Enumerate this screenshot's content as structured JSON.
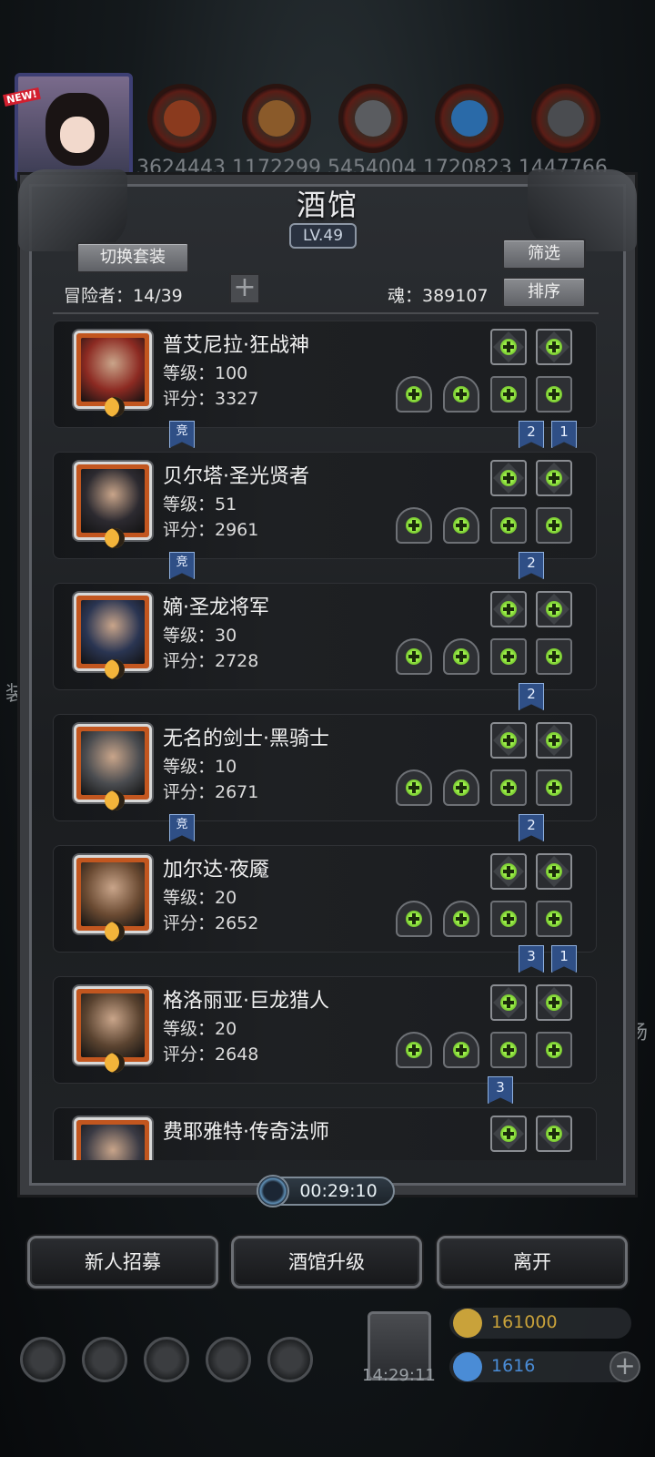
{
  "top_bar": {
    "new_badge": "NEW!",
    "resources_text": "3624443 1172299 5454004 1720823 1447766"
  },
  "tavern": {
    "title": "酒馆",
    "level": "LV.49",
    "switch_set_label": "切换套装",
    "filter_label": "筛选",
    "sort_label": "排序",
    "adventurers": "冒险者：14/39",
    "soul": "魂：389107",
    "heroes": [
      {
        "name": "普艾尼拉·狂战神",
        "level": "等级：100",
        "score": "评分：3327",
        "portrait_color": "#8c2a22",
        "jing": "竞",
        "ranks": [
          "2",
          "1"
        ]
      },
      {
        "name": "贝尔塔·圣光贤者",
        "level": "等级：51",
        "score": "评分：2961",
        "portrait_color": "#2c2a30",
        "jing": "竞",
        "ranks": [
          "2"
        ]
      },
      {
        "name": "嫡·圣龙将军",
        "level": "等级：30",
        "score": "评分：2728",
        "portrait_color": "#2a3552",
        "jing": "",
        "ranks": [
          "2"
        ]
      },
      {
        "name": "无名的剑士·黑骑士",
        "level": "等级：10",
        "score": "评分：2671",
        "portrait_color": "#4a4c50",
        "jing": "竞",
        "ranks": [
          "2"
        ]
      },
      {
        "name": "加尔达·夜魇",
        "level": "等级：20",
        "score": "评分：2652",
        "portrait_color": "#6a4a32",
        "jing": "",
        "ranks": [
          "3",
          "1"
        ]
      },
      {
        "name": "格洛丽亚·巨龙猎人",
        "level": "等级：20",
        "score": "评分：2648",
        "portrait_color": "#5a4330",
        "jing": "",
        "ranks": [
          "3"
        ]
      },
      {
        "name": "费耶雅特·传奇法师",
        "level": "",
        "score": "",
        "portrait_color": "#3a3a44",
        "jing": "",
        "ranks": []
      }
    ],
    "timer": "00:29:10",
    "buttons": {
      "recruit": "新人招募",
      "upgrade": "酒馆升级",
      "leave": "离开"
    }
  },
  "hud": {
    "time": "14:29:11",
    "gold": "161000",
    "gems": "1616",
    "gold_color": "#c9a23a",
    "gem_color": "#4a8cd6"
  },
  "background": {
    "left_char": "装",
    "right_char": "场"
  }
}
